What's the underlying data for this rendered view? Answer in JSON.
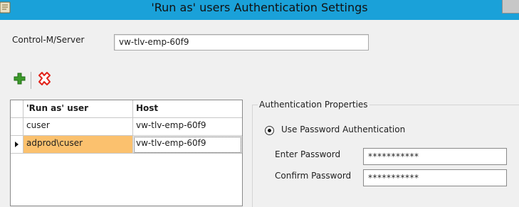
{
  "window": {
    "title": "'Run as' users Authentication Settings"
  },
  "server": {
    "label": "Control-M/Server",
    "value": "vw-tlv-emp-60f9"
  },
  "toolbar": {
    "add_icon": "plus-icon",
    "delete_icon": "red-x-icon"
  },
  "grid": {
    "columns": [
      "'Run as' user",
      "Host"
    ],
    "rows": [
      {
        "user": "cuser",
        "host": "vw-tlv-emp-60f9"
      },
      {
        "user": "adprod\\cuser",
        "host": "vw-tlv-emp-60f9"
      }
    ],
    "selected_row": 1
  },
  "auth": {
    "group_title": "Authentication Properties",
    "radio_label": "Use Password Authentication",
    "enter_password_label": "Enter Password",
    "enter_password_value": "***********",
    "confirm_password_label": "Confirm Password",
    "confirm_password_value": "***********"
  },
  "colors": {
    "titlebar": "#1aa1d9",
    "selection": "#fbc16e",
    "delete_red": "#e2231a",
    "add_green": "#3c9a2b"
  }
}
